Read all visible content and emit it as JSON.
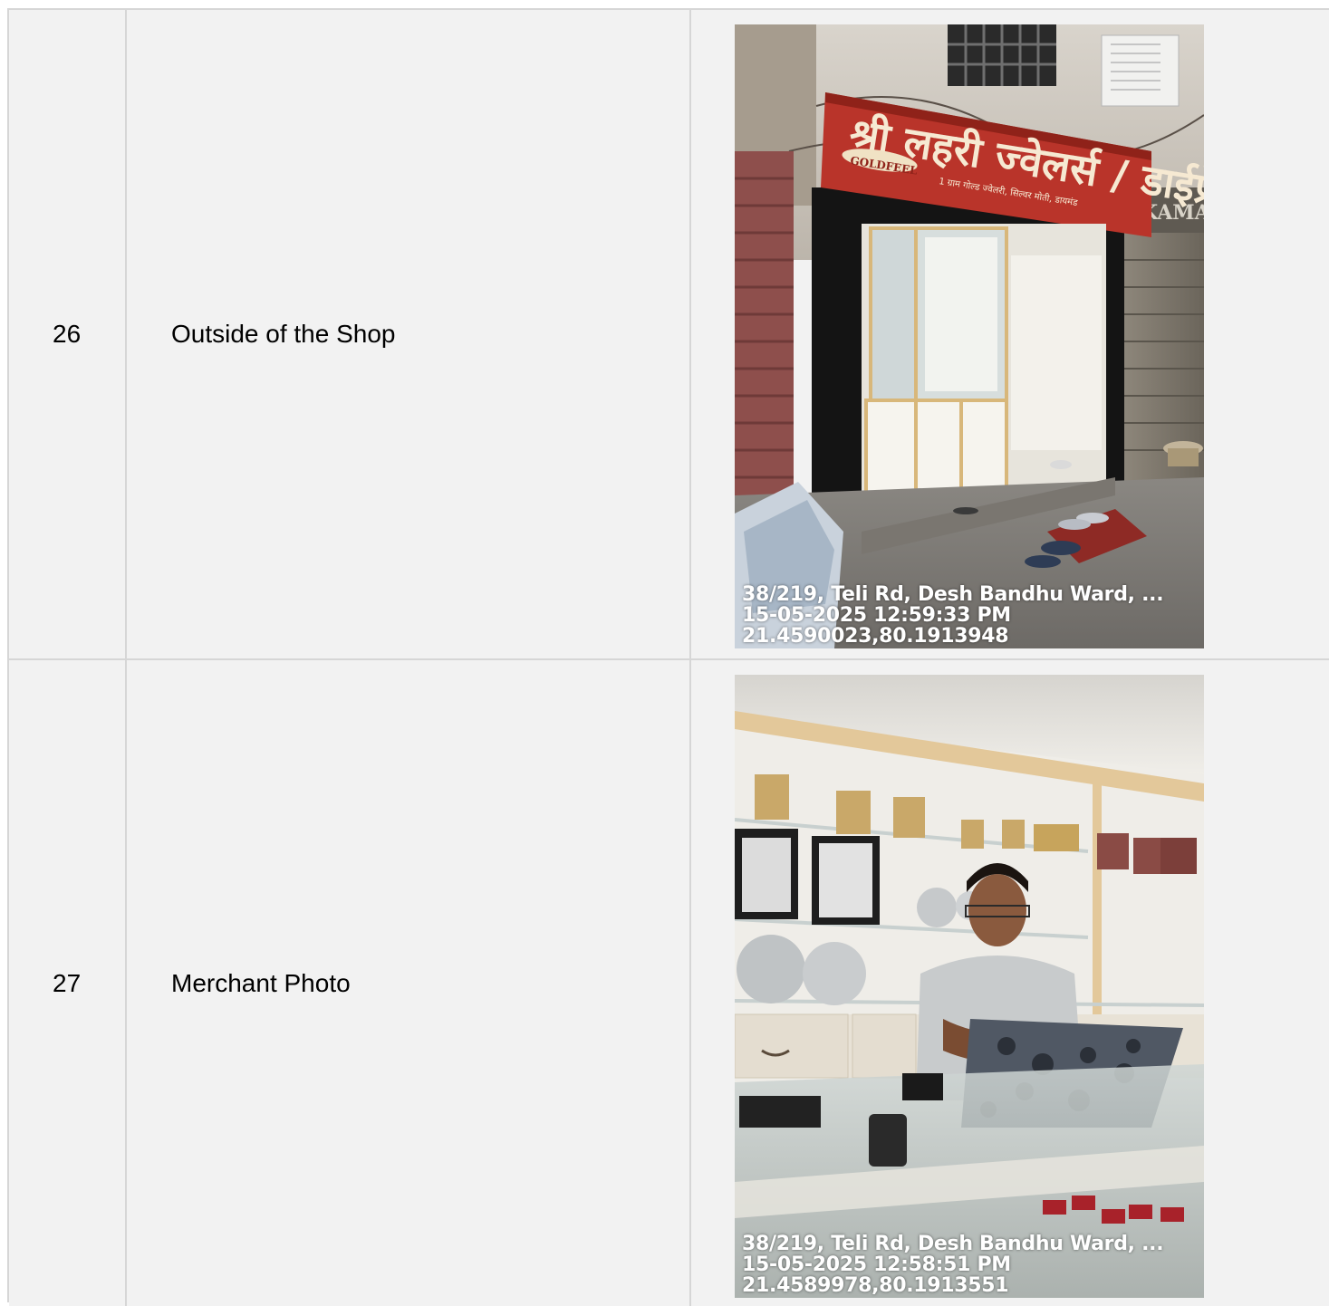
{
  "rows": [
    {
      "number": "26",
      "label": "Outside of the Shop",
      "photo": {
        "sign_main": "श्री लहरी ज्वेलर्स / डाईप्रेस",
        "sign_badge": "GOLDFEEL",
        "sign_sub": "1 ग्राम गोल्ड ज्वेलरी, सिल्वर मोती, डायमंड",
        "neighbor_sign": "KAMAL",
        "stamp_address": "38/219, Teli Rd, Desh Bandhu Ward, ...",
        "stamp_datetime": "15-05-2025 12:59:33 PM",
        "stamp_coords": "21.4590023,80.1913948"
      }
    },
    {
      "number": "27",
      "label": "Merchant Photo",
      "photo": {
        "stamp_address": "38/219, Teli Rd, Desh Bandhu Ward, ...",
        "stamp_datetime": "15-05-2025 12:58:51 PM",
        "stamp_coords": "21.4589978,80.1913551"
      }
    }
  ]
}
